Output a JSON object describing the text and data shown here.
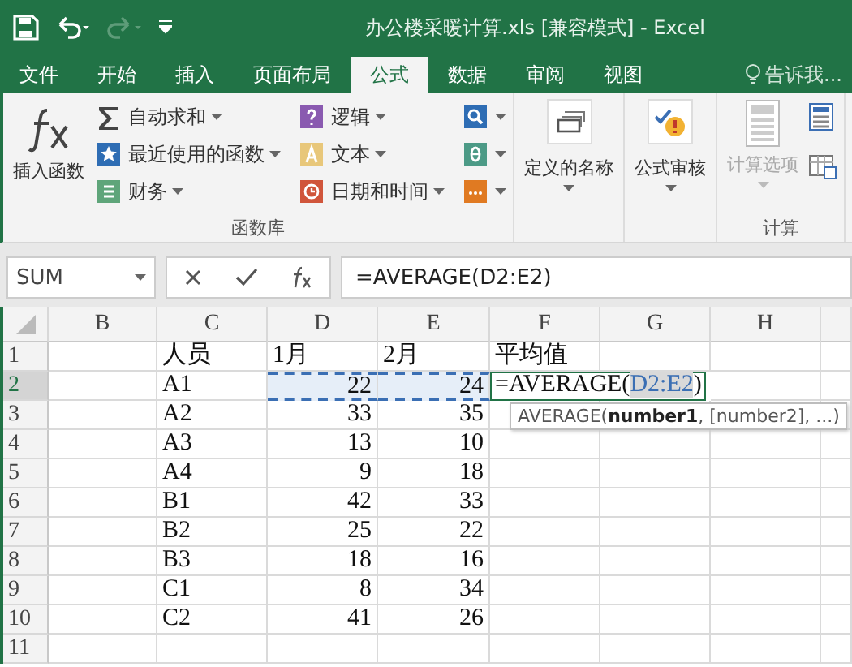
{
  "title_bar": {
    "title": "办公楼采暖计算.xls  [兼容模式] - Excel"
  },
  "tabs": [
    {
      "label": "文件",
      "selected": false
    },
    {
      "label": "开始",
      "selected": false
    },
    {
      "label": "插入",
      "selected": false
    },
    {
      "label": "页面布局",
      "selected": false
    },
    {
      "label": "公式",
      "selected": true
    },
    {
      "label": "数据",
      "selected": false
    },
    {
      "label": "审阅",
      "selected": false
    },
    {
      "label": "视图",
      "selected": false
    }
  ],
  "tell_me": "告诉我...",
  "ribbon": {
    "insert_function": "插入函数",
    "library_items": [
      {
        "label": "自动求和",
        "kind": "sum"
      },
      {
        "label": "最近使用的函数",
        "kind": "recent"
      },
      {
        "label": "财务",
        "kind": "finance"
      },
      {
        "label": "逻辑",
        "kind": "logic"
      },
      {
        "label": "文本",
        "kind": "text"
      },
      {
        "label": "日期和时间",
        "kind": "date"
      },
      {
        "kind": "lookup"
      },
      {
        "kind": "math"
      },
      {
        "kind": "more"
      }
    ],
    "library_label": "函数库",
    "defined_names": "定义的名称",
    "auditing": "公式审核",
    "calc_options": {
      "label": "计算选项",
      "disabled": true
    },
    "calc_label": "计算"
  },
  "formula_bar": {
    "name_box": "SUM",
    "formula": "=AVERAGE(D2:E2)"
  },
  "sheet": {
    "columns": [
      "B",
      "C",
      "D",
      "E",
      "F",
      "G",
      "H"
    ],
    "rows": [
      {
        "number": "1",
        "active": false,
        "cells": [
          "",
          "人员",
          "1月",
          "2月",
          "平均值",
          "",
          ""
        ]
      },
      {
        "number": "2",
        "active": true,
        "cells": [
          "",
          "A1",
          {
            "text": "22",
            "referenced": true
          },
          {
            "text": "24",
            "referenced": true
          },
          {
            "kind": "editing",
            "parts": [
              "=AVERAGE(",
              "D2:E2",
              ")"
            ]
          },
          "",
          ""
        ]
      },
      {
        "number": "3",
        "active": false,
        "cells": [
          "",
          "A2",
          "33",
          "35",
          "",
          "",
          ""
        ]
      },
      {
        "number": "4",
        "active": false,
        "cells": [
          "",
          "A3",
          "13",
          "10",
          "",
          "",
          ""
        ]
      },
      {
        "number": "5",
        "active": false,
        "cells": [
          "",
          "A4",
          "9",
          "18",
          "",
          "",
          ""
        ]
      },
      {
        "number": "6",
        "active": false,
        "cells": [
          "",
          "B1",
          "42",
          "33",
          "",
          "",
          ""
        ]
      },
      {
        "number": "7",
        "active": false,
        "cells": [
          "",
          "B2",
          "25",
          "22",
          "",
          "",
          ""
        ]
      },
      {
        "number": "8",
        "active": false,
        "cells": [
          "",
          "B3",
          "18",
          "16",
          "",
          "",
          ""
        ]
      },
      {
        "number": "9",
        "active": false,
        "cells": [
          "",
          "C1",
          "8",
          "34",
          "",
          "",
          ""
        ]
      },
      {
        "number": "10",
        "active": false,
        "cells": [
          "",
          "C2",
          "41",
          "26",
          "",
          "",
          ""
        ]
      },
      {
        "number": "11",
        "active": false,
        "cells": [
          "",
          "",
          "",
          "",
          "",
          "",
          ""
        ]
      }
    ],
    "tooltip": "AVERAGE(**number1**, [number2], ...)"
  }
}
